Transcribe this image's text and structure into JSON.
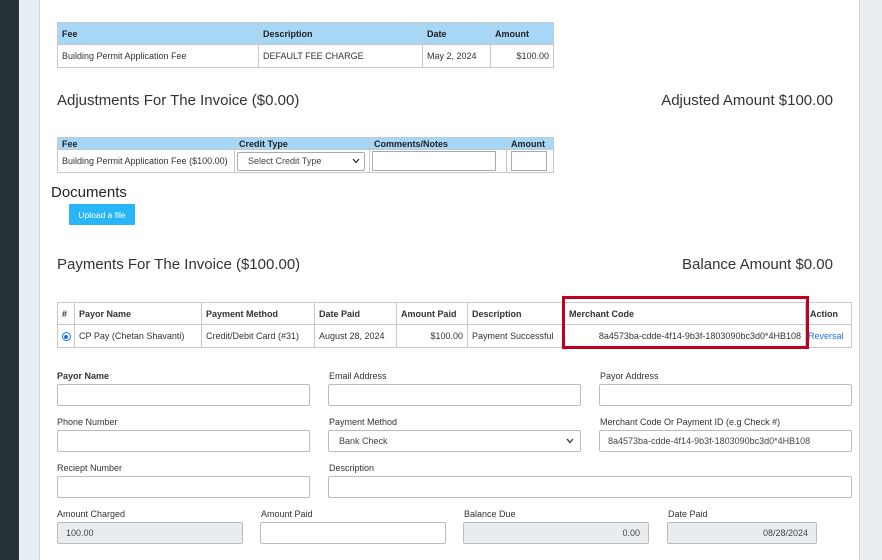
{
  "fee_table": {
    "headers": [
      "Fee",
      "Description",
      "Date",
      "Amount"
    ],
    "row": {
      "fee": "Building Permit Application Fee",
      "description": "DEFAULT FEE CHARGE",
      "date": "May 2, 2024",
      "amount": "$100.00"
    }
  },
  "adjustments": {
    "title": "Adjustments For The Invoice ($0.00)",
    "adjusted_amount": "Adjusted Amount $100.00",
    "headers": [
      "Fee",
      "Credit Type",
      "Comments/Notes",
      "Amount"
    ],
    "row": {
      "fee": "Building Permit Application Fee ($100.00)",
      "credit_type": "Select Credit Type"
    }
  },
  "documents": {
    "title": "Documents",
    "upload_label": "Upload a file"
  },
  "payments": {
    "title": "Payments For The Invoice ($100.00)",
    "balance_amount": "Balance Amount $0.00",
    "headers": [
      "#",
      "Payor Name",
      "Payment Method",
      "Date Paid",
      "Amount Paid",
      "Description",
      "Merchant Code",
      "Action"
    ],
    "row": {
      "payor": "CP Pay (Chetan Shavanti)",
      "method": "Credit/Debit Card (#31)",
      "date_paid": "August 28, 2024",
      "amount_paid": "$100.00",
      "description": "Payment Successful",
      "merchant_code": "8a4573ba-cdde-4f14-9b3f-1803090bc3d0*4HB108",
      "action": "Reversal"
    }
  },
  "form": {
    "payor_name_label": "Payor Name",
    "email_label": "Email Address",
    "payor_address_label": "Payor Address",
    "phone_label": "Phone Number",
    "payment_method_label": "Payment Method",
    "payment_method_value": "Bank Check",
    "merchant_label": "Merchant Code Or Payment ID (e.g Check #)",
    "merchant_value": "8a4573ba-cdde-4f14-9b3f-1803090bc3d0*4HB108",
    "receipt_label": "Reciept Number",
    "description_label": "Description",
    "amount_charged_label": "Amount Charged",
    "amount_charged_value": "100.00",
    "amount_paid_label": "Amount Paid",
    "balance_due_label": "Balance Due",
    "balance_due_value": "0.00",
    "date_paid_label": "Date Paid",
    "date_paid_value": "08/28/2024"
  }
}
